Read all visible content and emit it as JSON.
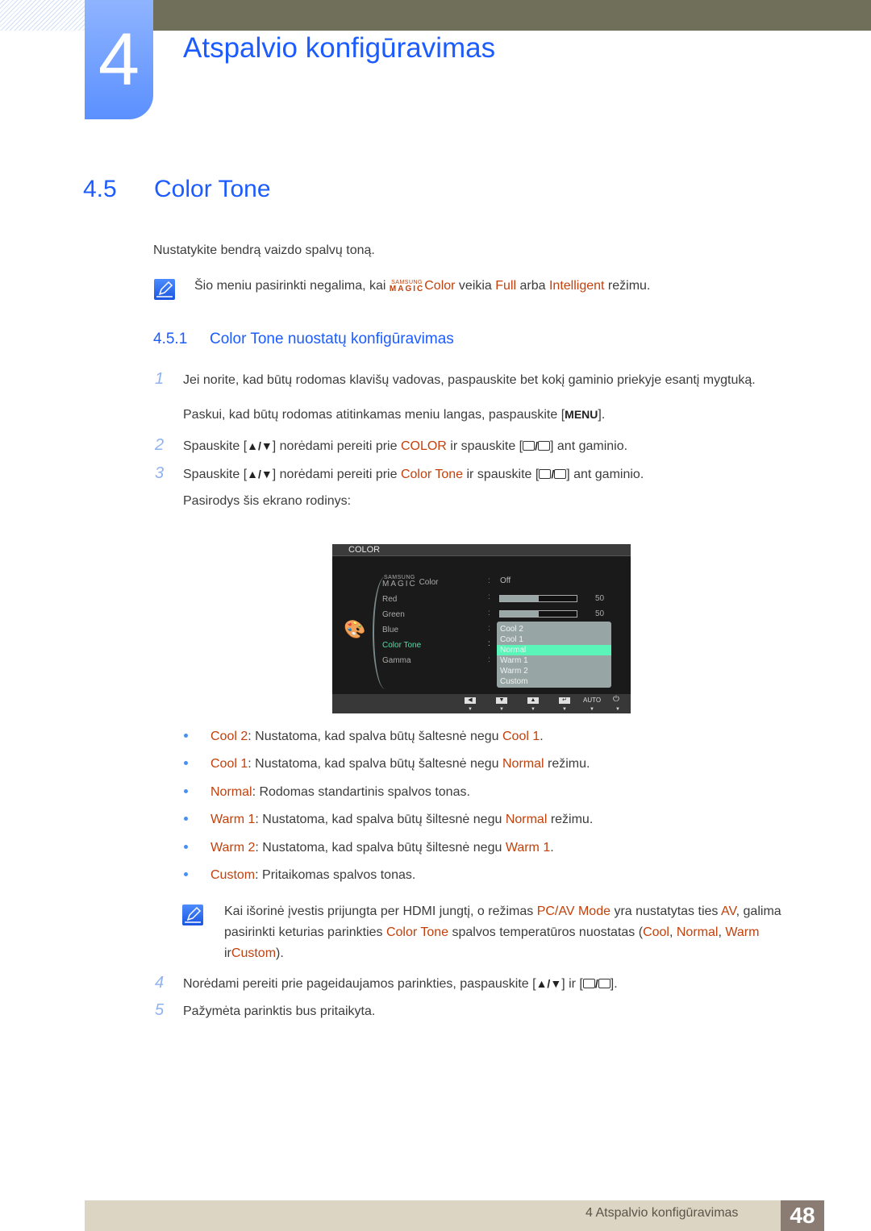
{
  "chapter": {
    "number": "4",
    "title": "Atspalvio konfigūravimas"
  },
  "section": {
    "number": "4.5",
    "title": "Color Tone"
  },
  "intro": "Nustatykite bendrą vaizdo spalvų toną.",
  "note1": {
    "icon": "note-pencil-icon",
    "part1": "Šio meniu pasirinkti negalima, kai ",
    "brand_top": "SAMSUNG",
    "brand_bottom": "MAGIC",
    "color_word": "Color",
    "part2": " veikia ",
    "full": "Full",
    "part3": " arba ",
    "intelligent": "Intelligent",
    "part4": " režimu."
  },
  "subsection": {
    "number": "4.5.1",
    "title": "Color Tone nuostatų konfigūravimas"
  },
  "steps": [
    {
      "num": "1",
      "text": "Jei norite, kad būtų rodomas klavišų vadovas, paspauskite bet kokį gaminio priekyje esantį mygtuką."
    },
    {
      "num": "",
      "text_pre": "Paskui, kad būtų rodomas atitinkamas meniu langas, paspauskite [",
      "key": "MENU",
      "text_post": "]."
    },
    {
      "num": "2",
      "pre": "Spauskite [",
      "arrows": "▲/▼",
      "mid": "] norėdami pereiti prie ",
      "target": "COLOR",
      "mid2": " ir spauskite [",
      "post": "] ant gaminio."
    },
    {
      "num": "3",
      "pre": "Spauskite [",
      "arrows": "▲/▼",
      "mid": "] norėdami pereiti prie ",
      "target": "Color Tone",
      "mid2": " ir spauskite [",
      "post": "] ant gaminio."
    },
    {
      "num": "",
      "text": "Pasirodys šis ekrano rodinys:"
    }
  ],
  "osd": {
    "header": "COLOR",
    "menu_items": [
      {
        "label": "Color",
        "brand_top": "SAMSUNG",
        "brand_bottom": "MAGIC",
        "value": "Off"
      },
      {
        "label": "Red",
        "slider": 0.5,
        "value": "50"
      },
      {
        "label": "Green",
        "slider": 0.5,
        "value": "50"
      },
      {
        "label": "Blue"
      },
      {
        "label": "Color Tone",
        "active": true
      },
      {
        "label": "Gamma"
      }
    ],
    "dropdown": [
      "Cool 2",
      "Cool 1",
      "Normal",
      "Warm 1",
      "Warm 2",
      "Custom"
    ],
    "selected": "Normal",
    "buttons": [
      "left-icon",
      "down-icon",
      "up-icon",
      "enter-icon",
      "AUTO",
      "power-icon"
    ],
    "auto_label": "AUTO"
  },
  "options": [
    {
      "name": "Cool 2",
      "desc": ": Nustatoma, kad spalva būtų šaltesnė negu ",
      "ref": "Cool 1",
      "tail": "."
    },
    {
      "name": "Cool 1",
      "desc": ": Nustatoma, kad spalva būtų šaltesnė negu ",
      "ref": "Normal",
      "tail": " režimu."
    },
    {
      "name": "Normal",
      "desc": ": Rodomas standartinis spalvos tonas.",
      "ref": "",
      "tail": ""
    },
    {
      "name": "Warm 1",
      "desc": ": Nustatoma, kad spalva būtų šiltesnė negu ",
      "ref": "Normal",
      "tail": " režimu."
    },
    {
      "name": "Warm 2",
      "desc": ": Nustatoma, kad spalva būtų šiltesnė negu ",
      "ref": "Warm 1",
      "tail": "."
    },
    {
      "name": "Custom",
      "desc": ": Pritaikomas spalvos tonas.",
      "ref": "",
      "tail": ""
    }
  ],
  "note2": {
    "l1a": "Kai išorinė įvestis prijungta per HDMI jungtį, o režimas ",
    "pcav": "PC/AV Mode",
    "l1b": " yra nustatytas ties ",
    "av": "AV",
    "l1c": ", galima",
    "l2a": "pasirinkti keturias parinkties ",
    "colortone": "Color Tone",
    "l2b": " spalvos temperatūros nuostatas (",
    "cool": "Cool",
    "comma1": ", ",
    "normal": "Normal",
    "comma2": ", ",
    "warm": "Warm",
    "l3a": "ir",
    "custom": "Custom",
    "l3b": ")."
  },
  "step4": {
    "num": "4",
    "pre": "Norėdami pereiti prie pageidaujamos parinkties, paspauskite [",
    "arrows": "▲/▼",
    "mid": "] ir [",
    "post": "]."
  },
  "step5": {
    "num": "5",
    "text": "Pažymėta parinktis bus pritaikyta."
  },
  "footer": {
    "chapter_label": "4 Atspalvio konfigūravimas",
    "page": "48"
  }
}
